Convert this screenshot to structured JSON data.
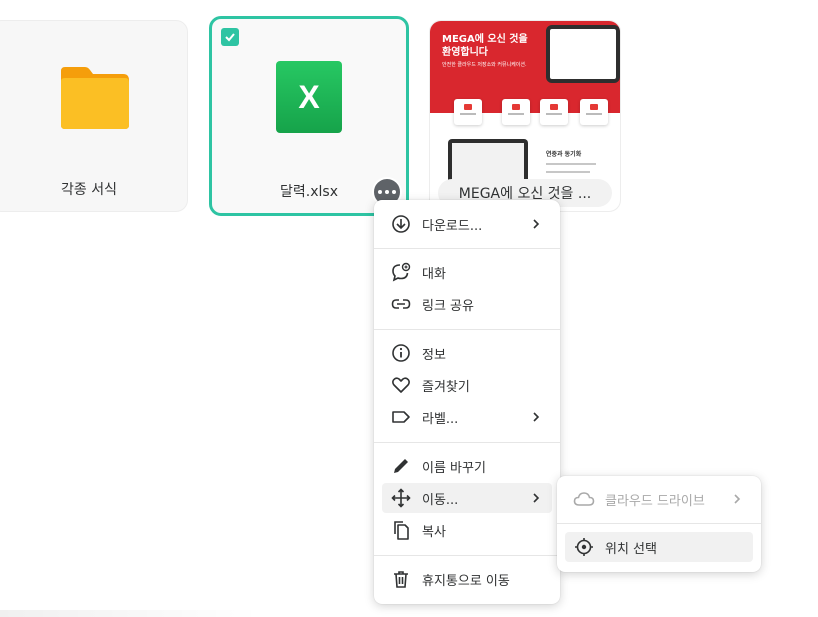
{
  "files": [
    {
      "name": "각종 서식",
      "type": "folder"
    },
    {
      "name": "달력.xlsx",
      "type": "excel",
      "icon_letter": "X",
      "selected": true
    },
    {
      "name": "MEGA에 오신 것을 ...",
      "type": "pdf-preview"
    }
  ],
  "thumbnail": {
    "title_line1": "MEGA에 오신 것을",
    "title_line2": "환영합니다",
    "subtitle": "안전한 클라우드 저장소와 커뮤니케이션.",
    "section_title": "연중과 동기화"
  },
  "context_menu": {
    "download": "다운로드...",
    "chat": "대화",
    "share_link": "링크 공유",
    "info": "정보",
    "favourite": "즐겨찾기",
    "label": "라벨...",
    "rename": "이름 바꾸기",
    "move": "이동...",
    "copy": "복사",
    "trash": "휴지통으로 이동"
  },
  "move_submenu": {
    "cloud_drive": "클라우드 드라이브",
    "select_location": "위치 선택"
  },
  "colors": {
    "accent": "#2ec4a3",
    "folder": "#f9b21b",
    "excel": "#1fb25a",
    "mega_red": "#d9272e"
  }
}
